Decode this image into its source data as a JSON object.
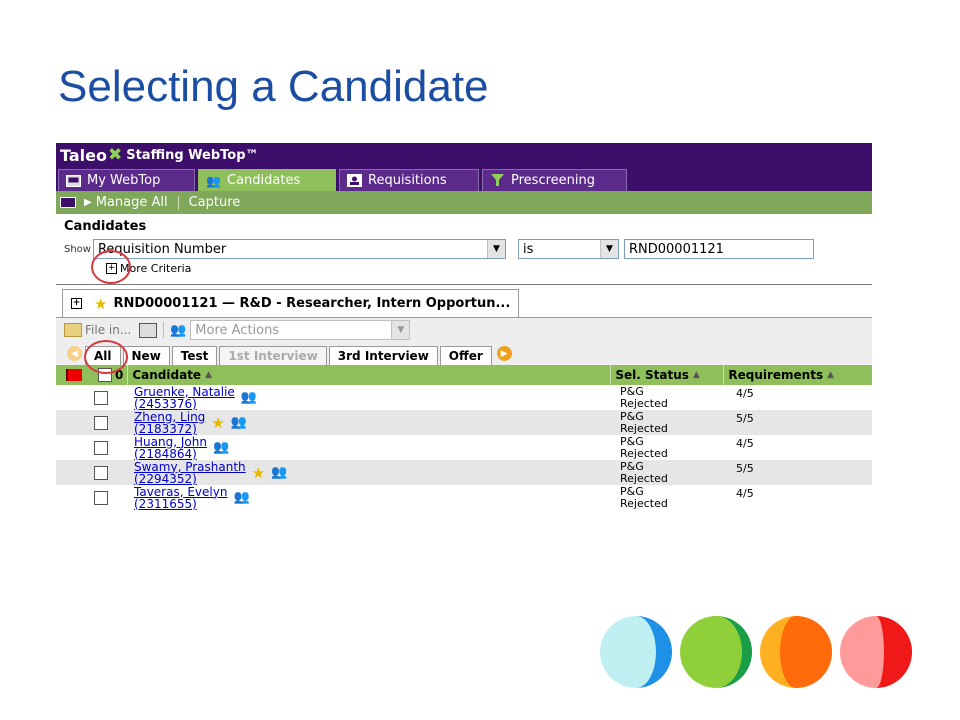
{
  "slide": {
    "title": "Selecting a Candidate"
  },
  "app": {
    "brand": "Taleo",
    "product": "Staffing WebTop™"
  },
  "tabs": [
    {
      "label": "My WebTop",
      "icon": "monitor-icon"
    },
    {
      "label": "Candidates",
      "icon": "people-icon",
      "active": true
    },
    {
      "label": "Requisitions",
      "icon": "id-card-icon"
    },
    {
      "label": "Prescreening",
      "icon": "funnel-icon"
    }
  ],
  "action_bar": {
    "manage_all": "Manage All",
    "capture": "Capture"
  },
  "candidates_panel": {
    "title": "Candidates",
    "show_label": "Show",
    "field_select": "Requisition Number",
    "operator_select": "is",
    "value": "RND00001121",
    "more_criteria": "More Criteria"
  },
  "requisition_tab": {
    "label": "RND00001121 — R&D - Researcher, Intern Opportun..."
  },
  "toolbar": {
    "file_in": "File in...",
    "more_actions": "More Actions"
  },
  "status_tabs": [
    "All",
    "New",
    "Test",
    "1st Interview",
    "3rd Interview",
    "Offer"
  ],
  "grid": {
    "count": "0",
    "columns": [
      "Candidate",
      "Sel. Status",
      "Requirements"
    ],
    "rows": [
      {
        "name": "Gruenke, Natalie",
        "id": "(2453376)",
        "status1": "P&G",
        "status2": "Rejected",
        "req": "4/5",
        "starred": false
      },
      {
        "name": "Zheng, Ling",
        "id": "(2183372)",
        "status1": "P&G",
        "status2": "Rejected",
        "req": "5/5",
        "starred": true
      },
      {
        "name": "Huang, John",
        "id": "(2184864)",
        "status1": "P&G",
        "status2": "Rejected",
        "req": "4/5",
        "starred": false
      },
      {
        "name": "Swamy, Prashanth",
        "id": "(2294352)",
        "status1": "P&G",
        "status2": "Rejected",
        "req": "5/5",
        "starred": true
      },
      {
        "name": "Taveras, Evelyn",
        "id": "(2311655)",
        "status1": "P&G",
        "status2": "Rejected",
        "req": "4/5",
        "starred": false
      }
    ]
  },
  "colors": {
    "title_blue": "#1b4ea3",
    "brand_purple": "#3d0f6a",
    "tab_green": "#8fbf5a",
    "annotation_red": "#d9393e",
    "dot_blue": "#1e90e6",
    "dot_blue_light": "#bfeff0",
    "dot_green": "#1a9e48",
    "dot_green_light": "#8fd03a",
    "dot_orange": "#ff6a0a",
    "dot_orange_light": "#ffb020",
    "dot_red": "#f01818",
    "dot_red_light": "#ff9a9a"
  }
}
